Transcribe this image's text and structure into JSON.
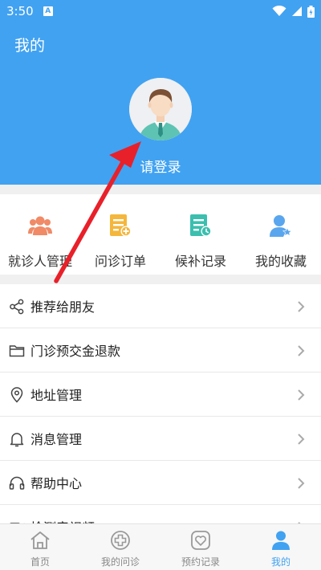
{
  "status_bar": {
    "time": "3:50",
    "notif_badge": "A"
  },
  "header": {
    "title": "我的",
    "login_prompt": "请登录"
  },
  "quick_actions": [
    {
      "label": "就诊人管理",
      "icon": "people-icon",
      "color": "#f08a67"
    },
    {
      "label": "问诊订单",
      "icon": "order-doc-icon",
      "color": "#f5b63c"
    },
    {
      "label": "候补记录",
      "icon": "record-clock-icon",
      "color": "#3cbfae"
    },
    {
      "label": "我的收藏",
      "icon": "user-star-icon",
      "color": "#5aa6ee"
    }
  ],
  "menu": [
    {
      "label": "推荐给朋友",
      "icon": "share-icon"
    },
    {
      "label": "门诊预交金退款",
      "icon": "folder-icon"
    },
    {
      "label": "地址管理",
      "icon": "location-pin-icon"
    },
    {
      "label": "消息管理",
      "icon": "bell-icon"
    },
    {
      "label": "帮助中心",
      "icon": "headset-icon"
    },
    {
      "label": "检测音视频",
      "icon": "video-icon"
    }
  ],
  "tabbar": [
    {
      "label": "首页",
      "icon": "home-icon",
      "active": false
    },
    {
      "label": "我的问诊",
      "icon": "plus-circle-icon",
      "active": false
    },
    {
      "label": "预约记录",
      "icon": "heart-icon",
      "active": false
    },
    {
      "label": "我的",
      "icon": "person-icon",
      "active": true
    }
  ],
  "colors": {
    "primary": "#41a2f1",
    "annotation_arrow": "#e8202a"
  }
}
